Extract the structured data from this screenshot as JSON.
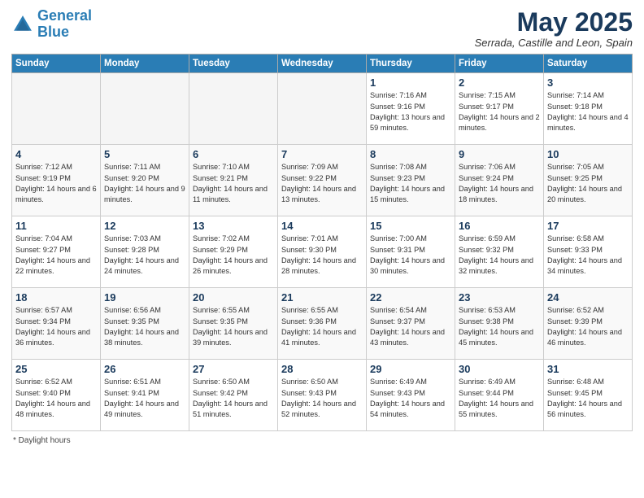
{
  "header": {
    "logo_line1": "General",
    "logo_line2": "Blue",
    "month_title": "May 2025",
    "location": "Serrada, Castille and Leon, Spain"
  },
  "days_of_week": [
    "Sunday",
    "Monday",
    "Tuesday",
    "Wednesday",
    "Thursday",
    "Friday",
    "Saturday"
  ],
  "weeks": [
    [
      {
        "day": "",
        "empty": true
      },
      {
        "day": "",
        "empty": true
      },
      {
        "day": "",
        "empty": true
      },
      {
        "day": "",
        "empty": true
      },
      {
        "day": "1",
        "sunrise": "Sunrise: 7:16 AM",
        "sunset": "Sunset: 9:16 PM",
        "daylight": "Daylight: 13 hours and 59 minutes."
      },
      {
        "day": "2",
        "sunrise": "Sunrise: 7:15 AM",
        "sunset": "Sunset: 9:17 PM",
        "daylight": "Daylight: 14 hours and 2 minutes."
      },
      {
        "day": "3",
        "sunrise": "Sunrise: 7:14 AM",
        "sunset": "Sunset: 9:18 PM",
        "daylight": "Daylight: 14 hours and 4 minutes."
      }
    ],
    [
      {
        "day": "4",
        "sunrise": "Sunrise: 7:12 AM",
        "sunset": "Sunset: 9:19 PM",
        "daylight": "Daylight: 14 hours and 6 minutes."
      },
      {
        "day": "5",
        "sunrise": "Sunrise: 7:11 AM",
        "sunset": "Sunset: 9:20 PM",
        "daylight": "Daylight: 14 hours and 9 minutes."
      },
      {
        "day": "6",
        "sunrise": "Sunrise: 7:10 AM",
        "sunset": "Sunset: 9:21 PM",
        "daylight": "Daylight: 14 hours and 11 minutes."
      },
      {
        "day": "7",
        "sunrise": "Sunrise: 7:09 AM",
        "sunset": "Sunset: 9:22 PM",
        "daylight": "Daylight: 14 hours and 13 minutes."
      },
      {
        "day": "8",
        "sunrise": "Sunrise: 7:08 AM",
        "sunset": "Sunset: 9:23 PM",
        "daylight": "Daylight: 14 hours and 15 minutes."
      },
      {
        "day": "9",
        "sunrise": "Sunrise: 7:06 AM",
        "sunset": "Sunset: 9:24 PM",
        "daylight": "Daylight: 14 hours and 18 minutes."
      },
      {
        "day": "10",
        "sunrise": "Sunrise: 7:05 AM",
        "sunset": "Sunset: 9:25 PM",
        "daylight": "Daylight: 14 hours and 20 minutes."
      }
    ],
    [
      {
        "day": "11",
        "sunrise": "Sunrise: 7:04 AM",
        "sunset": "Sunset: 9:27 PM",
        "daylight": "Daylight: 14 hours and 22 minutes."
      },
      {
        "day": "12",
        "sunrise": "Sunrise: 7:03 AM",
        "sunset": "Sunset: 9:28 PM",
        "daylight": "Daylight: 14 hours and 24 minutes."
      },
      {
        "day": "13",
        "sunrise": "Sunrise: 7:02 AM",
        "sunset": "Sunset: 9:29 PM",
        "daylight": "Daylight: 14 hours and 26 minutes."
      },
      {
        "day": "14",
        "sunrise": "Sunrise: 7:01 AM",
        "sunset": "Sunset: 9:30 PM",
        "daylight": "Daylight: 14 hours and 28 minutes."
      },
      {
        "day": "15",
        "sunrise": "Sunrise: 7:00 AM",
        "sunset": "Sunset: 9:31 PM",
        "daylight": "Daylight: 14 hours and 30 minutes."
      },
      {
        "day": "16",
        "sunrise": "Sunrise: 6:59 AM",
        "sunset": "Sunset: 9:32 PM",
        "daylight": "Daylight: 14 hours and 32 minutes."
      },
      {
        "day": "17",
        "sunrise": "Sunrise: 6:58 AM",
        "sunset": "Sunset: 9:33 PM",
        "daylight": "Daylight: 14 hours and 34 minutes."
      }
    ],
    [
      {
        "day": "18",
        "sunrise": "Sunrise: 6:57 AM",
        "sunset": "Sunset: 9:34 PM",
        "daylight": "Daylight: 14 hours and 36 minutes."
      },
      {
        "day": "19",
        "sunrise": "Sunrise: 6:56 AM",
        "sunset": "Sunset: 9:35 PM",
        "daylight": "Daylight: 14 hours and 38 minutes."
      },
      {
        "day": "20",
        "sunrise": "Sunrise: 6:55 AM",
        "sunset": "Sunset: 9:35 PM",
        "daylight": "Daylight: 14 hours and 39 minutes."
      },
      {
        "day": "21",
        "sunrise": "Sunrise: 6:55 AM",
        "sunset": "Sunset: 9:36 PM",
        "daylight": "Daylight: 14 hours and 41 minutes."
      },
      {
        "day": "22",
        "sunrise": "Sunrise: 6:54 AM",
        "sunset": "Sunset: 9:37 PM",
        "daylight": "Daylight: 14 hours and 43 minutes."
      },
      {
        "day": "23",
        "sunrise": "Sunrise: 6:53 AM",
        "sunset": "Sunset: 9:38 PM",
        "daylight": "Daylight: 14 hours and 45 minutes."
      },
      {
        "day": "24",
        "sunrise": "Sunrise: 6:52 AM",
        "sunset": "Sunset: 9:39 PM",
        "daylight": "Daylight: 14 hours and 46 minutes."
      }
    ],
    [
      {
        "day": "25",
        "sunrise": "Sunrise: 6:52 AM",
        "sunset": "Sunset: 9:40 PM",
        "daylight": "Daylight: 14 hours and 48 minutes."
      },
      {
        "day": "26",
        "sunrise": "Sunrise: 6:51 AM",
        "sunset": "Sunset: 9:41 PM",
        "daylight": "Daylight: 14 hours and 49 minutes."
      },
      {
        "day": "27",
        "sunrise": "Sunrise: 6:50 AM",
        "sunset": "Sunset: 9:42 PM",
        "daylight": "Daylight: 14 hours and 51 minutes."
      },
      {
        "day": "28",
        "sunrise": "Sunrise: 6:50 AM",
        "sunset": "Sunset: 9:43 PM",
        "daylight": "Daylight: 14 hours and 52 minutes."
      },
      {
        "day": "29",
        "sunrise": "Sunrise: 6:49 AM",
        "sunset": "Sunset: 9:43 PM",
        "daylight": "Daylight: 14 hours and 54 minutes."
      },
      {
        "day": "30",
        "sunrise": "Sunrise: 6:49 AM",
        "sunset": "Sunset: 9:44 PM",
        "daylight": "Daylight: 14 hours and 55 minutes."
      },
      {
        "day": "31",
        "sunrise": "Sunrise: 6:48 AM",
        "sunset": "Sunset: 9:45 PM",
        "daylight": "Daylight: 14 hours and 56 minutes."
      }
    ]
  ],
  "footnote": "Daylight hours"
}
